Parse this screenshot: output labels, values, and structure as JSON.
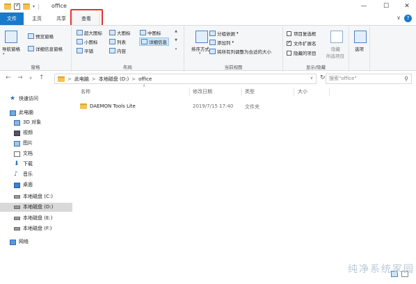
{
  "window": {
    "title": "office",
    "controls": {
      "minimize": "—",
      "maximize": "☐",
      "close": "✕"
    }
  },
  "tabs": {
    "file": "文件",
    "home": "主页",
    "share": "共享",
    "view": "查看",
    "collapse": "∨",
    "help": "?"
  },
  "ribbon": {
    "panes": {
      "label": "窗格",
      "nav_pane": "导航窗格",
      "preview_pane": "预览窗格",
      "details_pane": "详细信息窗格"
    },
    "layout": {
      "label": "布局",
      "extra_large": "超大图标",
      "large": "大图标",
      "medium": "中图标",
      "small": "小图标",
      "list": "列表",
      "details": "详细信息",
      "tiles": "平铺",
      "content": "内容"
    },
    "current_view": {
      "label": "当前视图",
      "sort_by": "排序方式",
      "group_by": "分组依据",
      "add_columns": "添加列",
      "size_all_columns": "将所有列调整为合适的大小"
    },
    "show_hide": {
      "label": "显示/隐藏",
      "item_checkboxes": "项目复选框",
      "file_extensions": "文件扩展名",
      "hidden_items": "隐藏的项目",
      "hide_selected": "隐藏",
      "hide_selected_2": "所选项目"
    },
    "options": "选项"
  },
  "address": {
    "back": "←",
    "forward": "→",
    "recent": "∨",
    "up": "↑",
    "path": [
      "此电脑",
      "本地磁盘 (D:)",
      "office"
    ],
    "separator": ">",
    "search_placeholder": "搜索\"office\""
  },
  "sidebar": {
    "quick_access": "快速访问",
    "this_pc": "此电脑",
    "items": [
      "3D 对象",
      "视频",
      "图片",
      "文档",
      "下载",
      "音乐",
      "桌面"
    ],
    "drives": [
      "本地磁盘 (C:)",
      "本地磁盘 (D:)",
      "本地磁盘 (E:)",
      "本地磁盘 (F:)"
    ],
    "network": "网络"
  },
  "content": {
    "columns": {
      "name": "名称",
      "date": "修改日期",
      "type": "类型",
      "size": "大小"
    },
    "rows": [
      {
        "name": "DAEMON Tools Lite",
        "date": "2019/7/15 17:40",
        "type": "文件夹",
        "size": ""
      }
    ]
  },
  "watermark": "纯净系统家园",
  "colors": {
    "accent": "#1979ca",
    "highlight_box": "#e0312d",
    "folder": "#f3c351"
  }
}
